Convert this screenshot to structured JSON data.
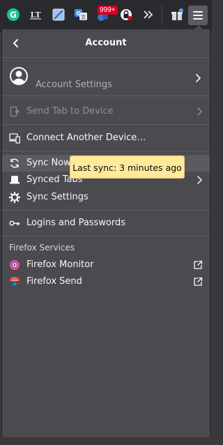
{
  "toolbar": {
    "badge_count": "999+",
    "icons": [
      "grammarly-icon",
      "lt-icon",
      "notes-icon",
      "translate-icon",
      "extension-badge-icon",
      "privacy-icon",
      "overflow-icon",
      "extensions-gift-icon",
      "hamburger-menu-icon"
    ]
  },
  "panel": {
    "title": "Account",
    "account_label": "Account Settings",
    "items": {
      "send_tab": "Send Tab to Device",
      "connect_device": "Connect Another Device…",
      "sync_now": "Sync Now",
      "synced_tabs": "Synced Tabs",
      "sync_settings": "Sync Settings",
      "logins": "Logins and Passwords"
    },
    "services_title": "Firefox Services",
    "services": {
      "monitor": "Firefox Monitor",
      "send": "Firefox Send"
    }
  },
  "tooltip": {
    "text": "Last sync: 3 minutes ago"
  },
  "colors": {
    "panel_bg": "#4a4a4f",
    "toolbar_bg": "#2a2a2e",
    "tooltip_bg": "#ffe99a",
    "badge_red": "#d70022"
  }
}
